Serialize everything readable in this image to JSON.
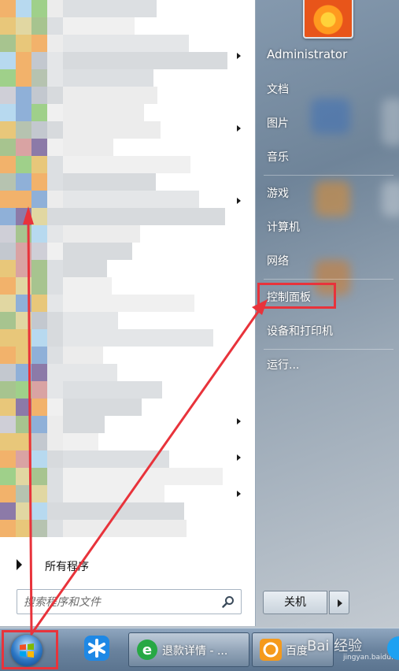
{
  "start_menu": {
    "right_pane": {
      "user_name": "Administrator",
      "items": [
        {
          "label": "文档"
        },
        {
          "label": "图片"
        },
        {
          "label": "音乐"
        },
        {
          "label": "游戏"
        },
        {
          "label": "计算机"
        },
        {
          "label": "网络"
        },
        {
          "label": "控制面板"
        },
        {
          "label": "设备和打印机"
        },
        {
          "label": "运行..."
        }
      ],
      "shutdown_label": "关机"
    },
    "left_pane": {
      "all_programs_label": "所有程序",
      "search_placeholder": "搜索程序和文件"
    }
  },
  "taskbar": {
    "ie_task_label": "退款详情 - ...",
    "baidu_task_label": "百度",
    "watermark": "Bai 经验",
    "watermark_sub": "jingyan.baidu.com"
  },
  "highlight_color": "#e8333b"
}
